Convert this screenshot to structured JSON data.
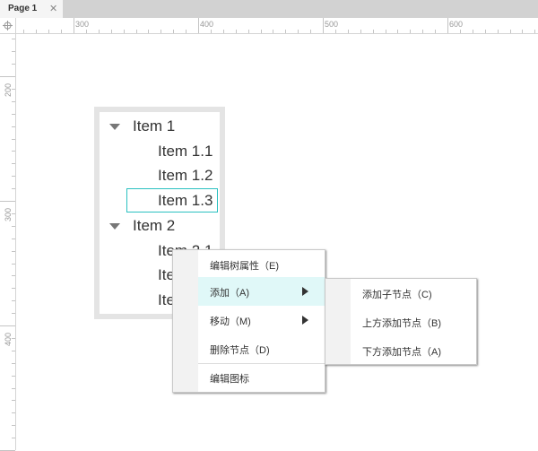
{
  "tabs": [
    {
      "label": "Page 1",
      "close_icon": "close-icon"
    }
  ],
  "rulers": {
    "horizontal_labels": [
      "300",
      "400",
      "500",
      "600"
    ],
    "vertical_labels": [
      "200",
      "300",
      "400"
    ]
  },
  "tree": {
    "nodes": [
      {
        "label": "Item 1",
        "expanded": true,
        "level": 0
      },
      {
        "label": "Item 1.1",
        "level": 1
      },
      {
        "label": "Item 1.2",
        "level": 1
      },
      {
        "label": "Item 1.3",
        "level": 1,
        "selected": true
      },
      {
        "label": "Item 2",
        "expanded": true,
        "level": 0
      },
      {
        "label": "Item 2.1",
        "level": 1
      },
      {
        "label": "Item 2.2",
        "level": 1
      },
      {
        "label": "Item 2.3",
        "level": 1
      }
    ]
  },
  "context_menu": {
    "items": [
      {
        "label": "编辑树属性（E)"
      },
      {
        "label": "添加（A)",
        "has_submenu": true,
        "active": true
      },
      {
        "label": "移动（M)",
        "has_submenu": true
      },
      {
        "label": "删除节点（D)"
      },
      {
        "label": "编辑图标"
      }
    ]
  },
  "submenu": {
    "items": [
      {
        "label": "添加子节点（C)"
      },
      {
        "label": "上方添加节点（B)"
      },
      {
        "label": "下方添加节点（A)"
      }
    ]
  },
  "colors": {
    "selection_border": "#2bc0c0",
    "menu_active_bg": "#e0f8f8"
  }
}
